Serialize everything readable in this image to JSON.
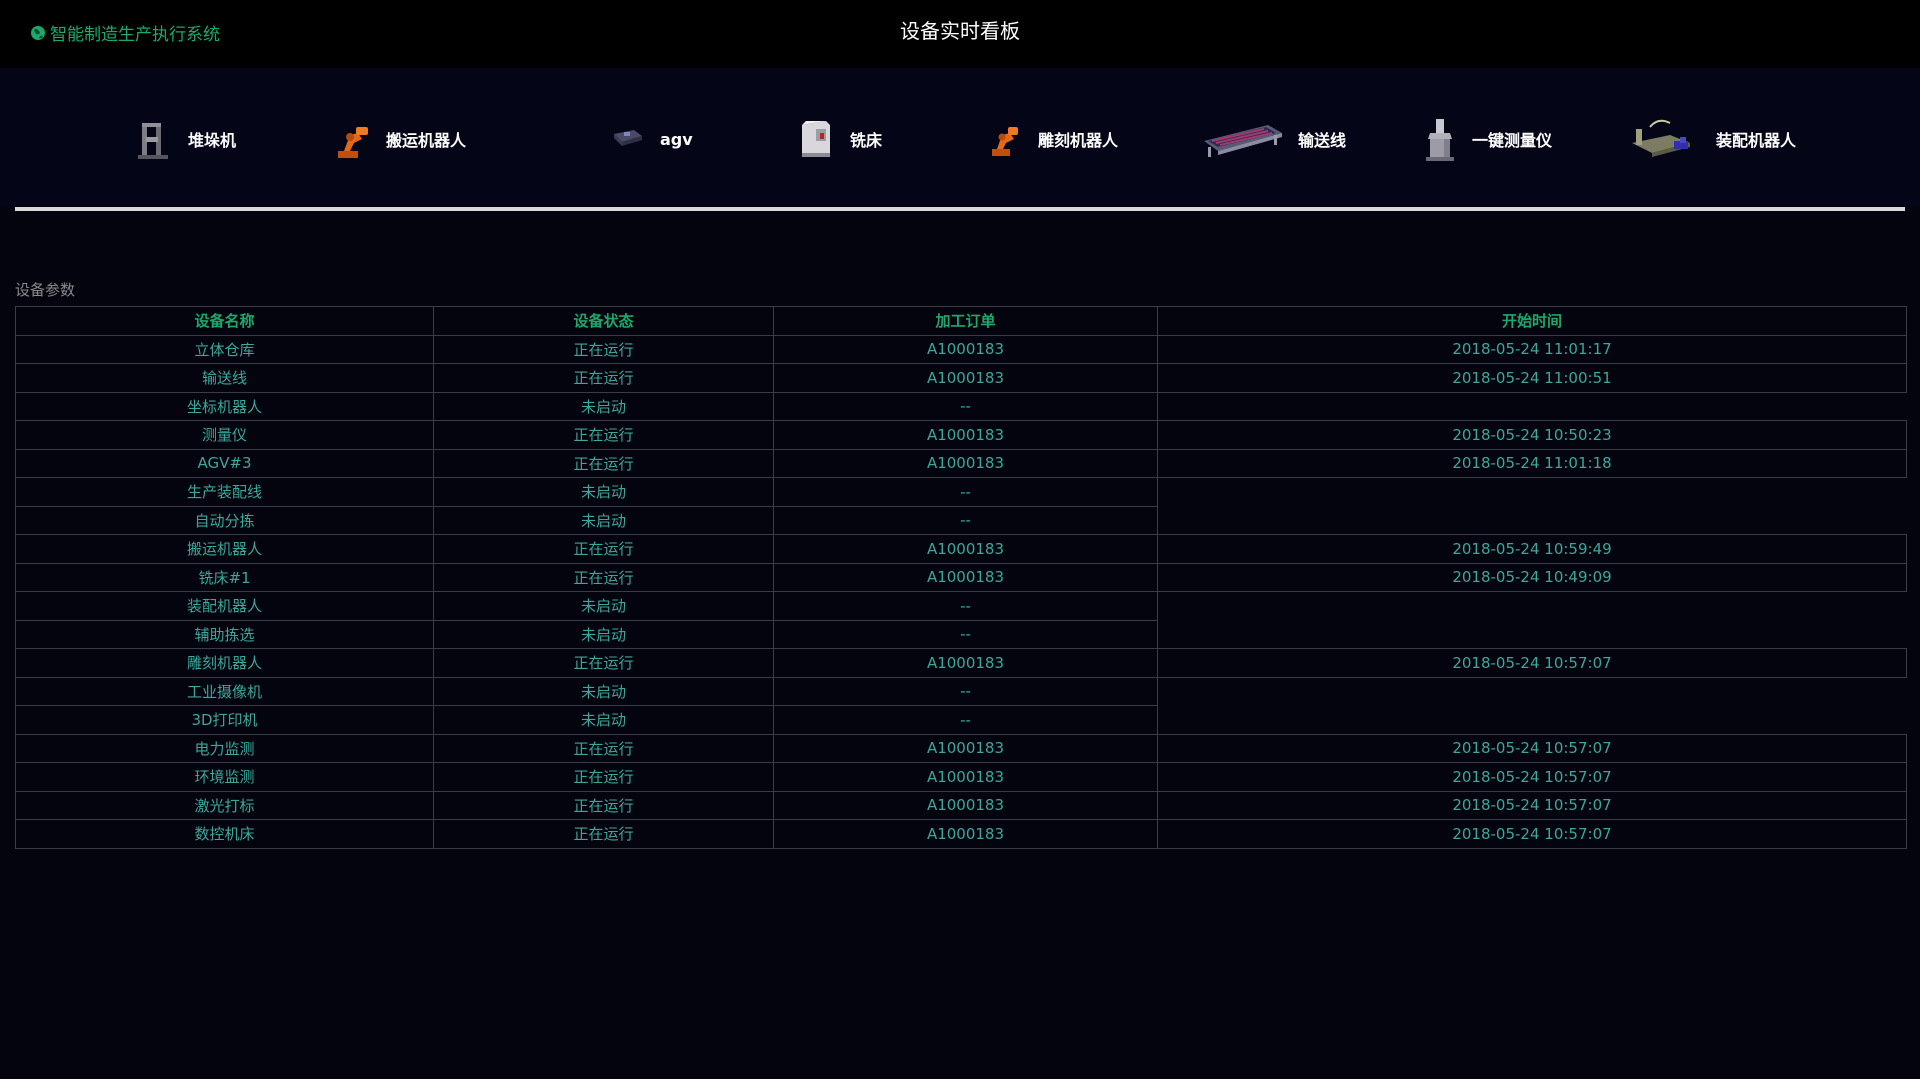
{
  "header": {
    "brand": "智能制造生产执行系统",
    "title": "设备实时看板"
  },
  "devices": [
    {
      "label": "堆垛机",
      "icon": "stacker-crane-icon"
    },
    {
      "label": "搬运机器人",
      "icon": "handling-robot-icon"
    },
    {
      "label": "agv",
      "icon": "agv-icon"
    },
    {
      "label": "铣床",
      "icon": "milling-machine-icon"
    },
    {
      "label": "雕刻机器人",
      "icon": "engraving-robot-icon"
    },
    {
      "label": "输送线",
      "icon": "conveyor-line-icon"
    },
    {
      "label": "一键测量仪",
      "icon": "measuring-instrument-icon"
    },
    {
      "label": "装配机器人",
      "icon": "assembly-robot-icon"
    }
  ],
  "section": {
    "title": "设备参数"
  },
  "table": {
    "headers": [
      "设备名称",
      "设备状态",
      "加工订单",
      "开始时间"
    ],
    "rows": [
      {
        "name": "立体仓库",
        "status": "正在运行",
        "order": "A1000183",
        "start": "2018-05-24 11:01:17"
      },
      {
        "name": "输送线",
        "status": "正在运行",
        "order": "A1000183",
        "start": "2018-05-24 11:00:51"
      },
      {
        "name": "坐标机器人",
        "status": "未启动",
        "order": "--",
        "start": ""
      },
      {
        "name": "测量仪",
        "status": "正在运行",
        "order": "A1000183",
        "start": "2018-05-24 10:50:23"
      },
      {
        "name": "AGV#3",
        "status": "正在运行",
        "order": "A1000183",
        "start": "2018-05-24 11:01:18"
      },
      {
        "name": "生产装配线",
        "status": "未启动",
        "order": "--",
        "start": ""
      },
      {
        "name": "自动分拣",
        "status": "未启动",
        "order": "--",
        "start": ""
      },
      {
        "name": "搬运机器人",
        "status": "正在运行",
        "order": "A1000183",
        "start": "2018-05-24 10:59:49"
      },
      {
        "name": "铣床#1",
        "status": "正在运行",
        "order": "A1000183",
        "start": "2018-05-24 10:49:09"
      },
      {
        "name": "装配机器人",
        "status": "未启动",
        "order": "--",
        "start": ""
      },
      {
        "name": "辅助拣选",
        "status": "未启动",
        "order": "--",
        "start": ""
      },
      {
        "name": "雕刻机器人",
        "status": "正在运行",
        "order": "A1000183",
        "start": "2018-05-24 10:57:07"
      },
      {
        "name": "工业摄像机",
        "status": "未启动",
        "order": "--",
        "start": ""
      },
      {
        "name": "3D打印机",
        "status": "未启动",
        "order": "--",
        "start": ""
      },
      {
        "name": "电力监测",
        "status": "正在运行",
        "order": "A1000183",
        "start": "2018-05-24 10:57:07"
      },
      {
        "name": "环境监测",
        "status": "正在运行",
        "order": "A1000183",
        "start": "2018-05-24 10:57:07"
      },
      {
        "name": "激光打标",
        "status": "正在运行",
        "order": "A1000183",
        "start": "2018-05-24 10:57:07"
      },
      {
        "name": "数控机床",
        "status": "正在运行",
        "order": "A1000183",
        "start": "2018-05-24 10:57:07"
      }
    ]
  },
  "colors": {
    "background": "#04040f",
    "header_background": "#000000",
    "brand_green": "#1aa96a",
    "cell_text": "#3aa89a",
    "border": "#3b3d44"
  }
}
